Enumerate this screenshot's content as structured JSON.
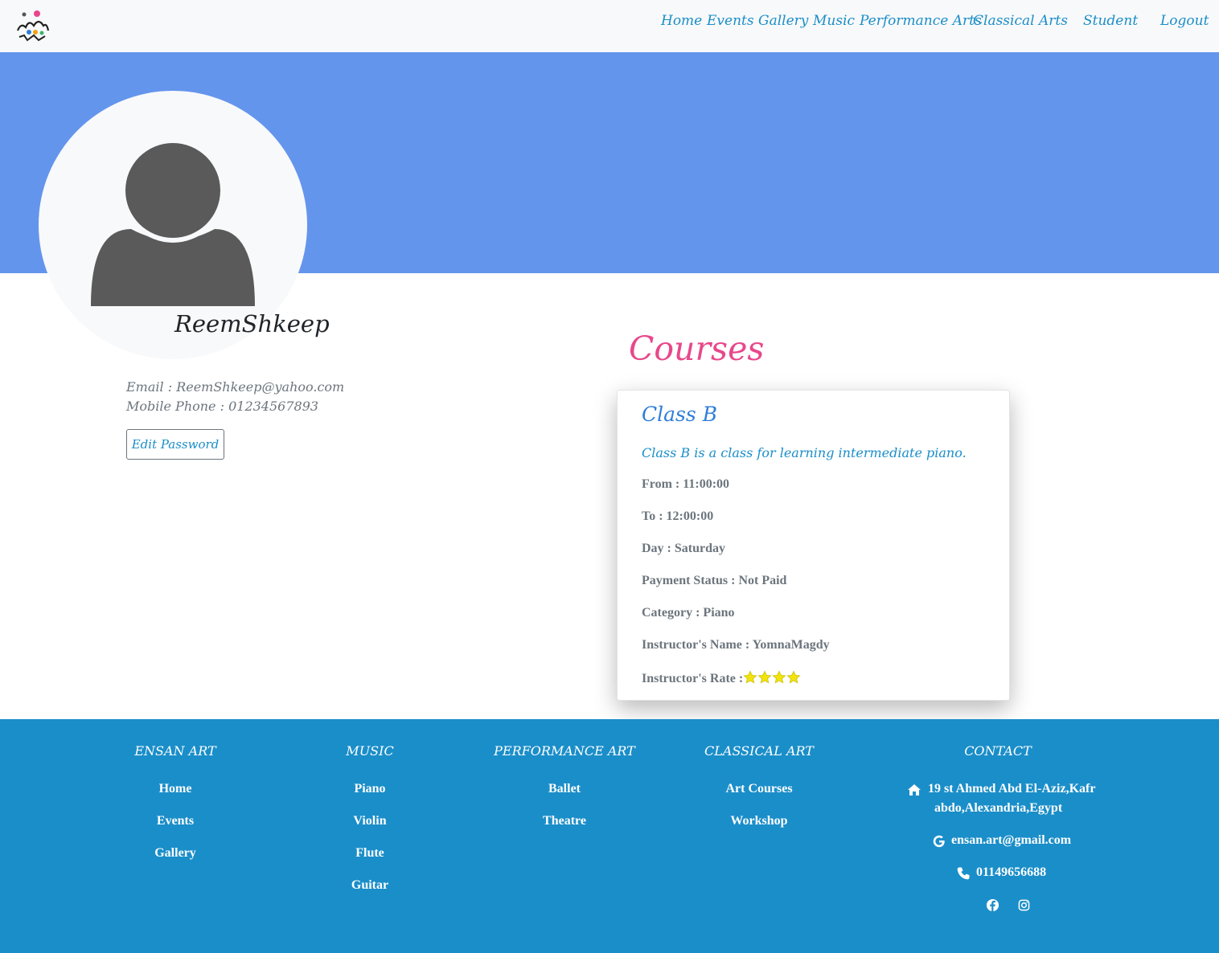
{
  "nav": {
    "logo_icon": "ensan-art-logo",
    "items": [
      {
        "label": "Home"
      },
      {
        "label": "Events"
      },
      {
        "label": "Gallery"
      },
      {
        "label": "Music"
      },
      {
        "label": "Performance Arts"
      },
      {
        "label": "Classical Arts"
      },
      {
        "label": "Student"
      },
      {
        "label": "Logout"
      }
    ]
  },
  "profile": {
    "avatar_icon": "user-silhouette-icon",
    "username": "ReemShkeep",
    "email_line": "Email : ReemShkeep@yahoo.com",
    "phone_line": "Mobile Phone : 01234567893",
    "edit_password_label": "Edit Password"
  },
  "courses": {
    "title": "Courses",
    "card": {
      "title": "Class B",
      "description": "Class B is a class for learning intermediate piano.",
      "from": "From : 11:00:00",
      "to": "To : 12:00:00",
      "day": "Day : Saturday",
      "payment_status": "Payment Status : Not Paid",
      "category": "Category : Piano",
      "instructor_name": "Instructor's Name : YomnaMagdy",
      "instructor_rate_label": "Instructor's Rate :",
      "instructor_rate_stars": 4,
      "star_color": "#f2e30d"
    }
  },
  "footer": {
    "columns": [
      {
        "heading": "ENSAN ART",
        "links": [
          "Home",
          "Events",
          "Gallery"
        ]
      },
      {
        "heading": "MUSIC",
        "links": [
          "Piano",
          "Violin",
          "Flute",
          "Guitar"
        ]
      },
      {
        "heading": "PERFORMANCE ART",
        "links": [
          "Ballet",
          "Theatre"
        ]
      },
      {
        "heading": "CLASSICAL ART",
        "links": [
          "Art Courses",
          "Workshop"
        ]
      }
    ],
    "contact": {
      "heading": "CONTACT",
      "address_line1": "19 st Ahmed Abd El-Aziz,Kafr",
      "address_line2": "abdo,Alexandria,Egypt",
      "email": "ensan.art@gmail.com",
      "phone": "01149656688",
      "icons": [
        "home-icon",
        "google-icon",
        "phone-icon",
        "facebook-icon",
        "instagram-icon"
      ]
    }
  },
  "colors": {
    "accent": "#1a8ec9",
    "banner": "#6495ed",
    "courses_title": "#e8488b",
    "card_title": "#2f7ed8"
  }
}
